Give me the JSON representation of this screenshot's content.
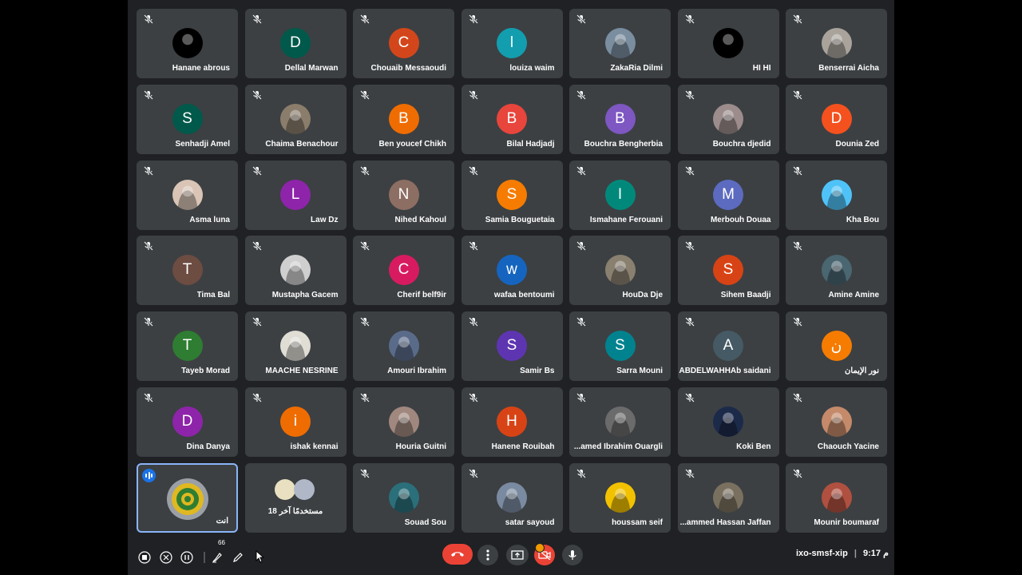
{
  "participants": [
    {
      "name": "Hanane abrous",
      "initial": "",
      "color": "#000000",
      "photo": true
    },
    {
      "name": "Dellal Marwan",
      "initial": "D",
      "color": "#00594a",
      "photo": false
    },
    {
      "name": "Chouaib Messaoudi",
      "initial": "C",
      "color": "#d3461b",
      "photo": false
    },
    {
      "name": "louiza waim",
      "initial": "l",
      "color": "#129eaf",
      "photo": false
    },
    {
      "name": "ZakaRia Dilmi",
      "initial": "",
      "color": "#7a8ea0",
      "photo": true
    },
    {
      "name": "HI HI",
      "initial": "",
      "color": "#000000",
      "photo": true
    },
    {
      "name": "Benserrai Aicha",
      "initial": "",
      "color": "#a9a39c",
      "photo": true
    },
    {
      "name": "Senhadji Amel",
      "initial": "S",
      "color": "#00594a",
      "photo": false
    },
    {
      "name": "Chaima Benachour",
      "initial": "",
      "color": "#8b7d6b",
      "photo": true
    },
    {
      "name": "Ben youcef Chikh",
      "initial": "B",
      "color": "#ef6c00",
      "photo": false
    },
    {
      "name": "Bilal Hadjadj",
      "initial": "B",
      "color": "#e8453c",
      "photo": false
    },
    {
      "name": "Bouchra Bengherbia",
      "initial": "B",
      "color": "#7e57c2",
      "photo": false
    },
    {
      "name": "Bouchra djedid",
      "initial": "",
      "color": "#9c8c8c",
      "photo": true
    },
    {
      "name": "Dounia Zed",
      "initial": "D",
      "color": "#f4511e",
      "photo": false
    },
    {
      "name": "Asma luna",
      "initial": "",
      "color": "#d9c4b6",
      "photo": true
    },
    {
      "name": "Law Dz",
      "initial": "L",
      "color": "#8e24aa",
      "photo": false
    },
    {
      "name": "Nihed Kahoul",
      "initial": "N",
      "color": "#8d6e63",
      "photo": false
    },
    {
      "name": "Samia Bouguetaia",
      "initial": "S",
      "color": "#f57c00",
      "photo": false
    },
    {
      "name": "Ismahane Ferouani",
      "initial": "I",
      "color": "#00897b",
      "photo": false
    },
    {
      "name": "Merbouh Douaa",
      "initial": "M",
      "color": "#5c6bc0",
      "photo": false
    },
    {
      "name": "Kha Bou",
      "initial": "",
      "color": "#4fc3f7",
      "photo": true
    },
    {
      "name": "Tima Bal",
      "initial": "T",
      "color": "#6d4c41",
      "photo": false
    },
    {
      "name": "Mustapha Gacem",
      "initial": "",
      "color": "#cfcfcf",
      "photo": true
    },
    {
      "name": "Cherif belf9ir",
      "initial": "C",
      "color": "#d81b60",
      "photo": false
    },
    {
      "name": "wafaa bentoumi",
      "initial": "w",
      "color": "#1565c0",
      "photo": false
    },
    {
      "name": "HouDa Dje",
      "initial": "",
      "color": "#8a8070",
      "photo": true
    },
    {
      "name": "Sihem Baadji",
      "initial": "S",
      "color": "#d84315",
      "photo": false
    },
    {
      "name": "Amine Amine",
      "initial": "",
      "color": "#4a6670",
      "photo": true
    },
    {
      "name": "Tayeb Morad",
      "initial": "T",
      "color": "#2e7d32",
      "photo": false
    },
    {
      "name": "MAACHE NESRINE",
      "initial": "",
      "color": "#e0ddd5",
      "photo": true
    },
    {
      "name": "Amouri Ibrahim",
      "initial": "",
      "color": "#5a6b8a",
      "photo": true
    },
    {
      "name": "Samir Bs",
      "initial": "S",
      "color": "#5e35b1",
      "photo": false
    },
    {
      "name": "Sarra Mouni",
      "initial": "S",
      "color": "#00838f",
      "photo": false
    },
    {
      "name": "ABDELWAHHAb saidani",
      "initial": "A",
      "color": "#455a64",
      "photo": false
    },
    {
      "name": "نور الإيمان",
      "initial": "ن",
      "color": "#f57c00",
      "photo": false
    },
    {
      "name": "Dina Danya",
      "initial": "D",
      "color": "#8e24aa",
      "photo": false
    },
    {
      "name": "ishak kennai",
      "initial": "i",
      "color": "#ef6c00",
      "photo": false
    },
    {
      "name": "Houria Guitni",
      "initial": "",
      "color": "#a1887f",
      "photo": true
    },
    {
      "name": "Hanene Rouibah",
      "initial": "H",
      "color": "#d84315",
      "photo": false
    },
    {
      "name": "...amed Ibrahim Ouargli",
      "initial": "",
      "color": "#6b6b6b",
      "photo": true
    },
    {
      "name": "Koki Ben",
      "initial": "",
      "color": "#1c2a4a",
      "photo": true
    },
    {
      "name": "Chaouch Yacine",
      "initial": "",
      "color": "#c48a6a",
      "photo": true
    }
  ],
  "last_row": [
    {
      "name": "Souad Sou",
      "color": "#2b6f7a"
    },
    {
      "name": "satar sayoud",
      "color": "#7a8aa0"
    },
    {
      "name": "houssam seif",
      "color": "#f2c200"
    },
    {
      "name": "...ammed Hassan Jaffan",
      "color": "#7a7060"
    },
    {
      "name": "Mounir boumaraf",
      "color": "#b05040"
    }
  ],
  "self_tile": {
    "label": "أنت"
  },
  "others_tile": {
    "label": "18 مستخدمًا آخر"
  },
  "meeting": {
    "code": "ixo-smsf-xip",
    "time": "9:17 م"
  },
  "annotation": {
    "count": "66"
  },
  "colors": {
    "end_call": "#ea4335",
    "tile": "#3c4043",
    "background": "#202124",
    "self_border": "#8ab4f8"
  },
  "icons": [
    "mic-off-icon",
    "end-call-icon",
    "more-vert-icon",
    "present-icon",
    "camera-off-icon",
    "mic-icon",
    "speaking-icon"
  ]
}
